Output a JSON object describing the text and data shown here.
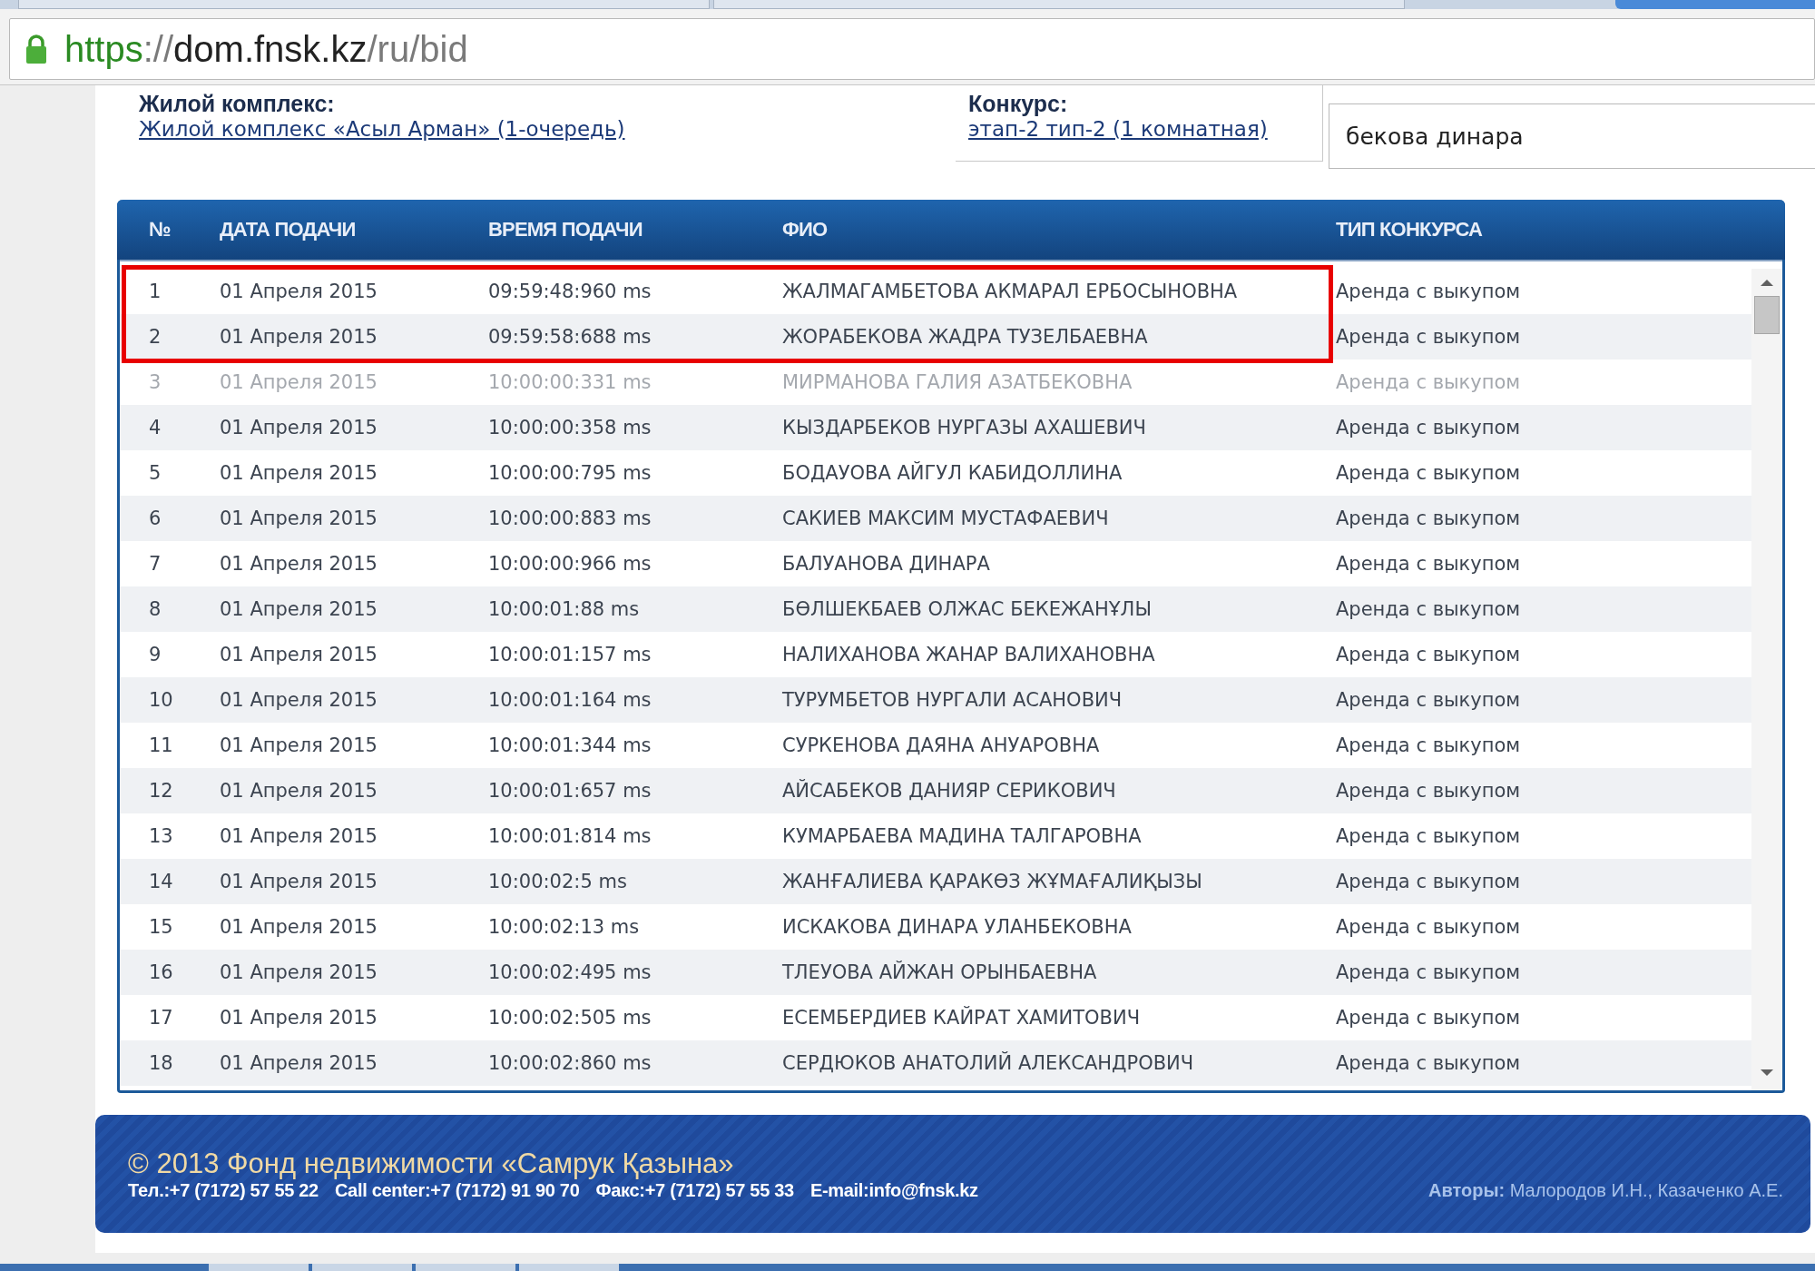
{
  "browser": {
    "url": {
      "scheme": "https",
      "separator": "://",
      "host": "dom.fnsk.kz",
      "path": "/ru/bid"
    }
  },
  "filters": {
    "complex": {
      "label": "Жилой комплекс:",
      "link": "Жилой комплекс «Асыл Арман» (1-очередь)"
    },
    "contest": {
      "label": "Конкурс:",
      "link": "этап-2 тип-2 (1 комнатная)"
    },
    "search": {
      "value": "бекова динара"
    }
  },
  "table": {
    "columns": [
      "№",
      "ДАТА ПОДАЧИ",
      "ВРЕМЯ ПОДАЧИ",
      "ФИО",
      "ТИП КОНКУРСА"
    ],
    "rows": [
      {
        "no": "1",
        "date": "01 Апреля 2015",
        "time": "09:59:48:960 ms",
        "name": "ЖАЛМАГАМБЕТОВА АКМАРАЛ ЕРБОСЫНОВНА",
        "type": "Аренда с выкупом",
        "dimmed": false,
        "highlighted": true
      },
      {
        "no": "2",
        "date": "01 Апреля 2015",
        "time": "09:59:58:688 ms",
        "name": "ЖОРАБЕКОВА ЖАДРА ТУЗЕЛБАЕВНА",
        "type": "Аренда с выкупом",
        "dimmed": false,
        "highlighted": true
      },
      {
        "no": "3",
        "date": "01 Апреля 2015",
        "time": "10:00:00:331 ms",
        "name": "МИРМАНОВА ГАЛИЯ АЗАТБЕКОВНА",
        "type": "Аренда с выкупом",
        "dimmed": true,
        "highlighted": false
      },
      {
        "no": "4",
        "date": "01 Апреля 2015",
        "time": "10:00:00:358 ms",
        "name": "КЫЗДАРБЕКОВ НУРГАЗЫ АХАШЕВИЧ",
        "type": "Аренда с выкупом",
        "dimmed": false,
        "highlighted": false
      },
      {
        "no": "5",
        "date": "01 Апреля 2015",
        "time": "10:00:00:795 ms",
        "name": "БОДАУОВА АЙГУЛ КАБИДОЛЛИНА",
        "type": "Аренда с выкупом",
        "dimmed": false,
        "highlighted": false
      },
      {
        "no": "6",
        "date": "01 Апреля 2015",
        "time": "10:00:00:883 ms",
        "name": "САКИЕВ МАКСИМ МУСТАФАЕВИЧ",
        "type": "Аренда с выкупом",
        "dimmed": false,
        "highlighted": false
      },
      {
        "no": "7",
        "date": "01 Апреля 2015",
        "time": "10:00:00:966 ms",
        "name": "БАЛУАНОВА ДИНАРА",
        "type": "Аренда с выкупом",
        "dimmed": false,
        "highlighted": false
      },
      {
        "no": "8",
        "date": "01 Апреля 2015",
        "time": "10:00:01:88 ms",
        "name": "БӨЛШЕКБАЕВ ОЛЖАС БЕКЕЖАНҰЛЫ",
        "type": "Аренда с выкупом",
        "dimmed": false,
        "highlighted": false
      },
      {
        "no": "9",
        "date": "01 Апреля 2015",
        "time": "10:00:01:157 ms",
        "name": "НАЛИХАНОВА ЖАНАР ВАЛИХАНОВНА",
        "type": "Аренда с выкупом",
        "dimmed": false,
        "highlighted": false
      },
      {
        "no": "10",
        "date": "01 Апреля 2015",
        "time": "10:00:01:164 ms",
        "name": "ТУРУМБЕТОВ НУРГАЛИ АСАНОВИЧ",
        "type": "Аренда с выкупом",
        "dimmed": false,
        "highlighted": false
      },
      {
        "no": "11",
        "date": "01 Апреля 2015",
        "time": "10:00:01:344 ms",
        "name": "СУРКЕНОВА ДАЯНА АНУАРОВНА",
        "type": "Аренда с выкупом",
        "dimmed": false,
        "highlighted": false
      },
      {
        "no": "12",
        "date": "01 Апреля 2015",
        "time": "10:00:01:657 ms",
        "name": "АЙСАБЕКОВ ДАНИЯР СЕРИКОВИЧ",
        "type": "Аренда с выкупом",
        "dimmed": false,
        "highlighted": false
      },
      {
        "no": "13",
        "date": "01 Апреля 2015",
        "time": "10:00:01:814 ms",
        "name": "КУМАРБАЕВА МАДИНА ТАЛГАРОВНА",
        "type": "Аренда с выкупом",
        "dimmed": false,
        "highlighted": false
      },
      {
        "no": "14",
        "date": "01 Апреля 2015",
        "time": "10:00:02:5 ms",
        "name": "ЖАНҒАЛИЕВА ҚАРАКӨЗ ЖҰМАҒАЛИҚЫЗЫ",
        "type": "Аренда с выкупом",
        "dimmed": false,
        "highlighted": false
      },
      {
        "no": "15",
        "date": "01 Апреля 2015",
        "time": "10:00:02:13 ms",
        "name": "ИСКАКОВА ДИНАРА УЛАНБЕКОВНА",
        "type": "Аренда с выкупом",
        "dimmed": false,
        "highlighted": false
      },
      {
        "no": "16",
        "date": "01 Апреля 2015",
        "time": "10:00:02:495 ms",
        "name": "ТЛЕУОВА АЙЖАН ОРЫНБАЕВНА",
        "type": "Аренда с выкупом",
        "dimmed": false,
        "highlighted": false
      },
      {
        "no": "17",
        "date": "01 Апреля 2015",
        "time": "10:00:02:505 ms",
        "name": "ЕСЕМБЕРДИЕВ КАЙРАТ ХАМИТОВИЧ",
        "type": "Аренда с выкупом",
        "dimmed": false,
        "highlighted": false
      },
      {
        "no": "18",
        "date": "01 Апреля 2015",
        "time": "10:00:02:860 ms",
        "name": "СЕРДЮКОВ АНАТОЛИЙ АЛЕКСАНДРОВИЧ",
        "type": "Аренда с выкупом",
        "dimmed": false,
        "highlighted": false
      }
    ]
  },
  "footer": {
    "copyright": "© 2013 Фонд недвижимости «Самрук Қазына»",
    "contacts": [
      "Тел.:+7 (7172) 57 55 22",
      "Call center:+7 (7172) 91 90 70",
      "Факс:+7 (7172) 57 55 33",
      "E-mail:info@fnsk.kz"
    ],
    "authors": "**Авторы:** Малородов И.Н., Казаченко А.Е."
  }
}
